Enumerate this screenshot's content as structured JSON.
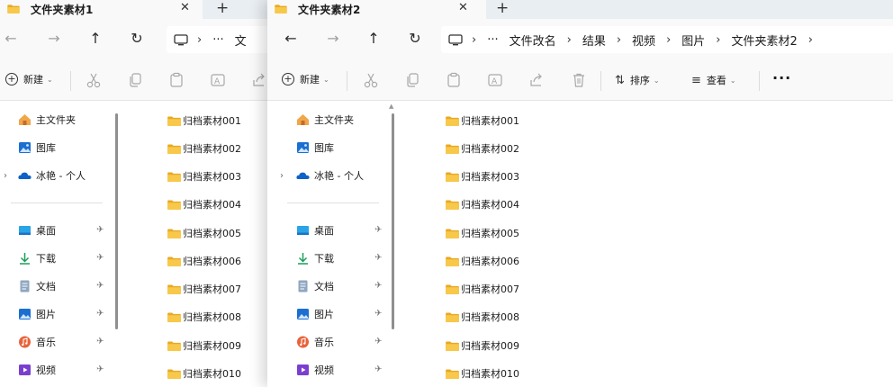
{
  "window1": {
    "tab_title": "文件夹素材1",
    "close_glyph": "✕",
    "new_tab_glyph": "+",
    "breadcrumb": [
      "文"
    ],
    "toolbar": {
      "new_label": "新建"
    },
    "sidebar": {
      "top": [
        {
          "label": "主文件夹",
          "icon": "home-icon"
        },
        {
          "label": "图库",
          "icon": "gallery-icon"
        },
        {
          "label": "冰艳 - 个人",
          "icon": "onedrive-cloud-icon"
        }
      ],
      "pinned": [
        {
          "label": "桌面",
          "icon": "desktop-icon"
        },
        {
          "label": "下载",
          "icon": "download-icon"
        },
        {
          "label": "文档",
          "icon": "document-icon"
        },
        {
          "label": "图片",
          "icon": "pictures-icon"
        },
        {
          "label": "音乐",
          "icon": "music-icon"
        },
        {
          "label": "视频",
          "icon": "video-icon"
        }
      ]
    },
    "files": [
      "归档素材001",
      "归档素材002",
      "归档素材003",
      "归档素材004",
      "归档素材005",
      "归档素材006",
      "归档素材007",
      "归档素材008",
      "归档素材009",
      "归档素材010"
    ]
  },
  "window2": {
    "tab_title": "文件夹素材2",
    "close_glyph": "✕",
    "new_tab_glyph": "+",
    "breadcrumb": [
      "···",
      "文件改名",
      "结果",
      "视频",
      "图片",
      "文件夹素材2"
    ],
    "toolbar": {
      "new_label": "新建",
      "sort_label": "排序",
      "view_label": "查看",
      "more_label": "···"
    },
    "sidebar": {
      "top": [
        {
          "label": "主文件夹",
          "icon": "home-icon"
        },
        {
          "label": "图库",
          "icon": "gallery-icon"
        },
        {
          "label": "冰艳 - 个人",
          "icon": "onedrive-cloud-icon"
        }
      ],
      "pinned": [
        {
          "label": "桌面",
          "icon": "desktop-icon"
        },
        {
          "label": "下载",
          "icon": "download-icon"
        },
        {
          "label": "文档",
          "icon": "document-icon"
        },
        {
          "label": "图片",
          "icon": "pictures-icon"
        },
        {
          "label": "音乐",
          "icon": "music-icon"
        },
        {
          "label": "视频",
          "icon": "video-icon"
        }
      ]
    },
    "files": [
      "归档素材001",
      "归档素材002",
      "归档素材003",
      "归档素材004",
      "归档素材005",
      "归档素材006",
      "归档素材007",
      "归档素材008",
      "归档素材009",
      "归档素材010"
    ]
  },
  "colors": {
    "folder": "#f8c84a",
    "accent": "#0067c0",
    "background": "#f9f9f9"
  }
}
